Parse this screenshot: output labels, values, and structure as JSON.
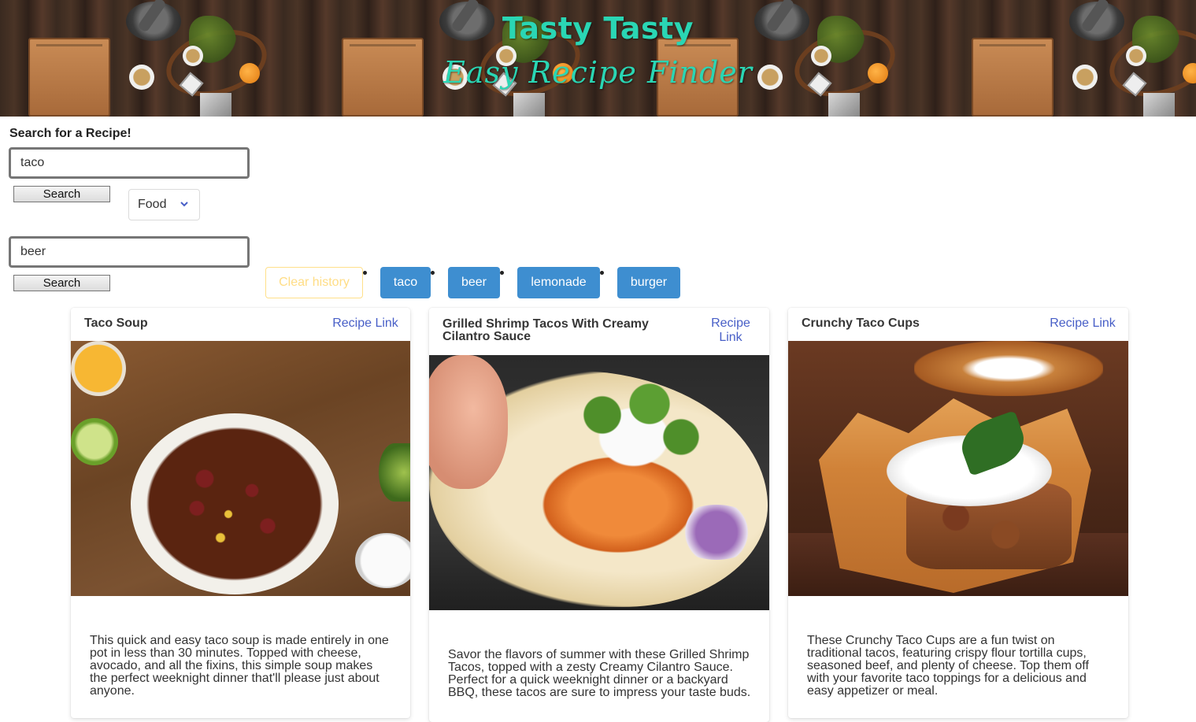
{
  "banner": {
    "title": "Tasty Tasty",
    "subtitle": "Easy Recipe Finder"
  },
  "search": {
    "heading": "Search for a Recipe!",
    "food_query": "taco",
    "food_button": "Search",
    "category_select": "Food",
    "drink_query": "beer",
    "drink_button": "Search"
  },
  "history": {
    "clear_label": "Clear history",
    "items": [
      "taco",
      "beer",
      "lemonade",
      "burger"
    ]
  },
  "recipes": [
    {
      "title": "Taco Soup",
      "link_label": "Recipe Link",
      "description": "This quick and easy taco soup is made entirely in one pot in less than 30 minutes. Topped with cheese, avocado, and all the fixins, this simple soup makes the perfect weeknight dinner that'll please just about anyone."
    },
    {
      "title": "Grilled Shrimp Tacos With Creamy Cilantro Sauce",
      "link_label": "Recipe Link",
      "description": "Savor the flavors of summer with these Grilled Shrimp Tacos, topped with a zesty Creamy Cilantro Sauce. Perfect for a quick weeknight dinner or a backyard BBQ, these tacos are sure to impress your taste buds."
    },
    {
      "title": "Crunchy Taco Cups",
      "link_label": "Recipe Link",
      "description": "These Crunchy Taco Cups are a fun twist on traditional tacos, featuring crispy flour tortilla cups, seasoned beef, and plenty of cheese. Top them off with your favorite taco toppings for a delicious and easy appetizer or meal."
    }
  ],
  "colors": {
    "banner_text": "#2ad6b4",
    "history_button": "#3e8ed0",
    "clear_button_text": "#ffdd85",
    "link": "#485fc7"
  }
}
